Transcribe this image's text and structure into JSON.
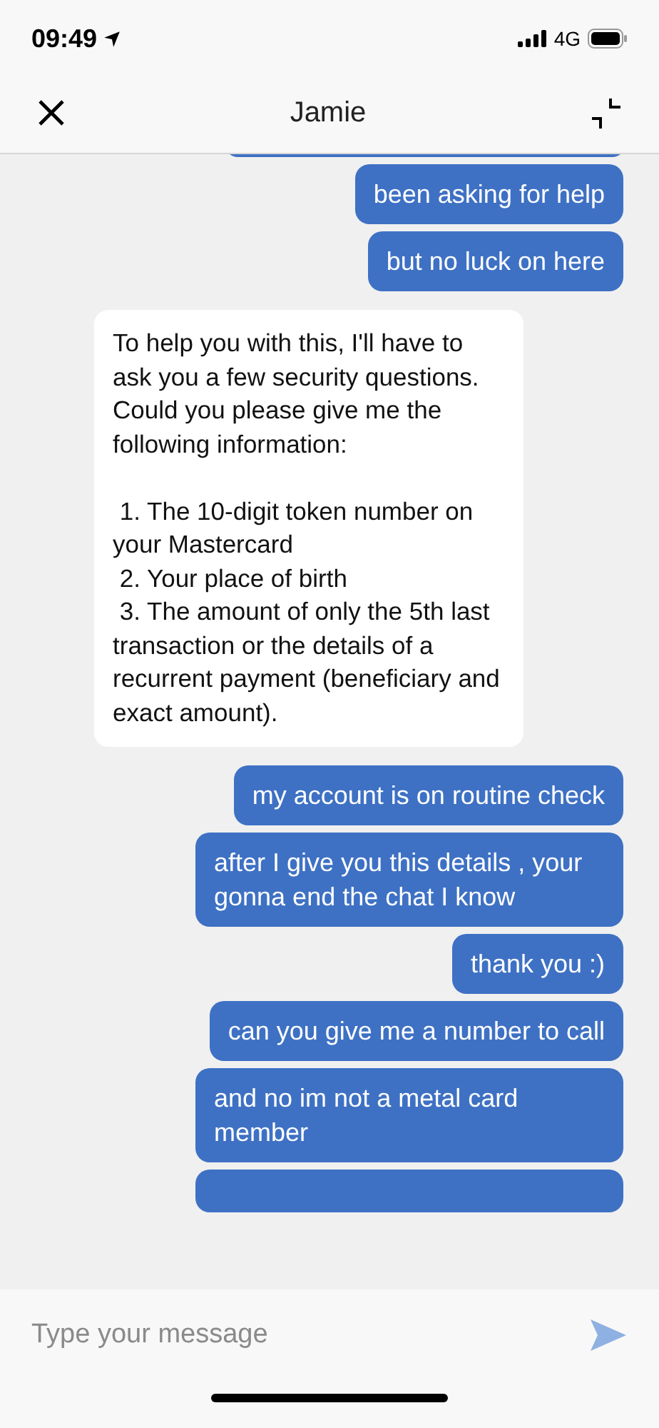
{
  "status_bar": {
    "time": "09:49",
    "network": "4G"
  },
  "header": {
    "title": "Jamie"
  },
  "messages": [
    {
      "kind": "user",
      "text": "been asking for help"
    },
    {
      "kind": "user",
      "text": "but no luck on here"
    },
    {
      "kind": "agent",
      "text": "To help you with this, I'll have to ask you a few security questions. Could you please give me the following information:\n\n 1. The 10-digit token number on your Mastercard\n 2. Your place of birth\n 3. The amount of only the 5th last transaction or the details of a recurrent payment (beneficiary and exact amount)."
    },
    {
      "kind": "user",
      "text": "my account is on routine check"
    },
    {
      "kind": "user",
      "text": "after I give you this details , your gonna end the chat I know"
    },
    {
      "kind": "user",
      "text": "thank you :)"
    },
    {
      "kind": "user",
      "text": "can you give me a number to call"
    },
    {
      "kind": "user",
      "text": "and no im not a metal card member"
    }
  ],
  "composer": {
    "placeholder": "Type your message"
  }
}
